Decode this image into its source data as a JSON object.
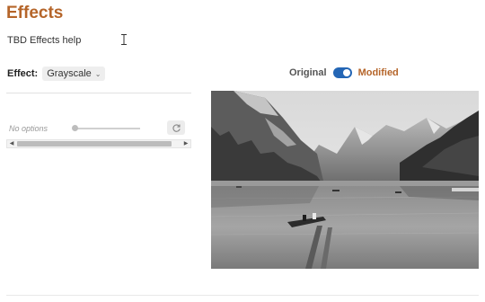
{
  "header": {
    "title": "Effects",
    "help_text": "TBD Effects help"
  },
  "effect": {
    "label": "Effect:",
    "selected": "Grayscale"
  },
  "view_toggle": {
    "original_label": "Original",
    "modified_label": "Modified",
    "state": "modified"
  },
  "options": {
    "no_options_text": "No options"
  },
  "preview": {
    "description_icon": "landscape-photo-grayscale"
  },
  "colors": {
    "accent": "#b5652a",
    "toggle_on": "#2466b5"
  }
}
